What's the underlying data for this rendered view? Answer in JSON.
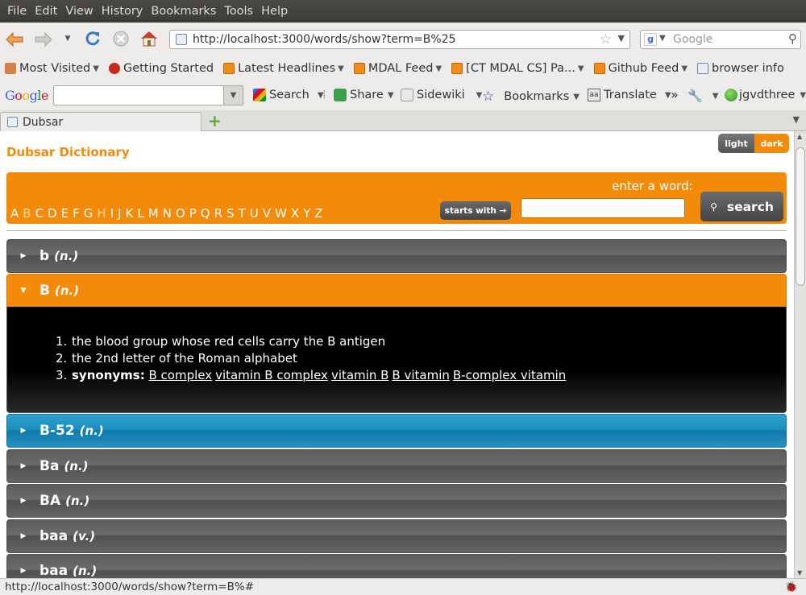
{
  "menu": [
    "File",
    "Edit",
    "View",
    "History",
    "Bookmarks",
    "Tools",
    "Help"
  ],
  "nav": {
    "back_icon": "back-arrow-icon",
    "forward_icon": "forward-arrow-icon",
    "history_icon": "chevron-down-icon",
    "reload_icon": "reload-icon",
    "stop_icon": "stop-icon",
    "home_icon": "home-icon",
    "url": "http://localhost:3000/words/show?term=B%25",
    "search_placeholder": "Google"
  },
  "bookmarks": [
    {
      "label": "Most Visited",
      "icon": "most-visited-icon",
      "dropdown": true
    },
    {
      "label": "Getting Started",
      "icon": "firefox-icon",
      "dropdown": false
    },
    {
      "label": "Latest Headlines",
      "icon": "rss-icon",
      "dropdown": true
    },
    {
      "label": "MDAL Feed",
      "icon": "rss-icon",
      "dropdown": true
    },
    {
      "label": "[CT MDAL CS] Pa...",
      "icon": "rss-icon",
      "dropdown": true
    },
    {
      "label": "Github Feed",
      "icon": "rss-icon",
      "dropdown": true
    },
    {
      "label": "browser info",
      "icon": "page-icon",
      "dropdown": false
    }
  ],
  "google_toolbar": {
    "logo": "Google",
    "search_label": "Search",
    "share_label": "Share",
    "sidewiki_label": "Sidewiki",
    "bookmarks_label": "Bookmarks",
    "translate_label": "Translate",
    "overflow": "»",
    "user_label": "jgvdthree"
  },
  "tab": {
    "title": "Dubsar"
  },
  "page": {
    "site_title": "Dubsar Dictionary",
    "theme_light": "light",
    "theme_dark": "dark",
    "letters": [
      "A",
      "B",
      "C",
      "D",
      "E",
      "F",
      "G",
      "H",
      "I",
      "J",
      "K",
      "L",
      "M",
      "N",
      "O",
      "P",
      "Q",
      "R",
      "S",
      "T",
      "U",
      "V",
      "W",
      "X",
      "Y",
      "Z"
    ],
    "enter_label": "enter a word:",
    "starts_with_label": "starts with →",
    "search_label": "search",
    "search_value": "",
    "entries": [
      {
        "word": "b",
        "pos": "(n.)",
        "state": "collapsed"
      },
      {
        "word": "B",
        "pos": "(n.)",
        "state": "expanded"
      },
      {
        "word": "B-52",
        "pos": "(n.)",
        "state": "hover"
      },
      {
        "word": "Ba",
        "pos": "(n.)",
        "state": "collapsed"
      },
      {
        "word": "BA",
        "pos": "(n.)",
        "state": "collapsed"
      },
      {
        "word": "baa",
        "pos": "(v.)",
        "state": "collapsed"
      },
      {
        "word": "baa",
        "pos": "(n.)",
        "state": "collapsed"
      }
    ],
    "definitions": {
      "items": [
        "the blood group whose red cells carry the B antigen",
        "the 2nd letter of the Roman alphabet"
      ],
      "synonyms_label": "synonyms:",
      "synonyms": [
        "B complex",
        "vitamin B complex",
        "vitamin B",
        "B vitamin",
        "B-complex vitamin"
      ]
    }
  },
  "status": {
    "text": "http://localhost:3000/words/show?term=B%#"
  },
  "colors": {
    "accent": "#f38a0a",
    "hover_blue": "#1c8fbe",
    "entry_gray": "#5c5c5c"
  }
}
